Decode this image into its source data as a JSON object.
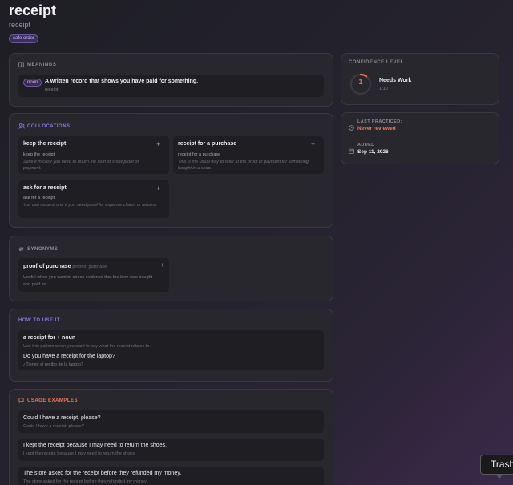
{
  "header": {
    "word": "receipt",
    "subtitle": "receipt",
    "tag": "cafe order"
  },
  "meanings": {
    "title": "MEANINGS",
    "pos": "noun",
    "definition": "A written record that shows you have paid for something.",
    "translation": "receipt"
  },
  "collocations": {
    "title": "COLLOCATIONS",
    "items": [
      {
        "phrase": "keep the receipt",
        "translation": "keep the receipt",
        "note": "Save it in case you need to return the item or show proof of payment."
      },
      {
        "phrase": "receipt for a purchase",
        "translation": "receipt for a purchase",
        "note": "This is the usual way to refer to the proof of payment for something bought in a shop."
      },
      {
        "phrase": "ask for a receipt",
        "translation": "ask for a receipt",
        "note": "You can request one if you need proof for expense claims or returns."
      }
    ],
    "add_glyph": "+"
  },
  "synonyms": {
    "title": "SYNONYMS",
    "word": "proof of purchase",
    "gloss": "- proof of purchase",
    "note": "Useful when you want to stress evidence that the item was bought and paid for.",
    "add_glyph": "+"
  },
  "how_to_use": {
    "title": "HOW TO USE IT",
    "pattern": "a receipt for + noun",
    "pattern_note": "Use this pattern when you want to say what the receipt relates to.",
    "example": "Do you have a receipt for the laptop?",
    "example_translation": "¿Tienes el recibo de la laptop?"
  },
  "usage_examples": {
    "title": "USAGE EXAMPLES",
    "items": [
      {
        "sentence": "Could I have a receipt, please?",
        "translation": "Could I have a receipt, please?"
      },
      {
        "sentence": "I kept the receipt because I may need to return the shoes.",
        "translation": "I kept the receipt because I may need to return the shoes."
      },
      {
        "sentence": "The store asked for the receipt before they refunded my money.",
        "translation": "The store asked for the receipt before they refunded my money."
      }
    ]
  },
  "confidence": {
    "title": "CONFIDENCE LEVEL",
    "value": "1",
    "level": 0.1,
    "label": "Needs Work",
    "score": "1/10"
  },
  "practice": {
    "last_label": "LAST PRACTICED:",
    "last_value": "Never reviewed",
    "added_label": "ADDED",
    "added_value": "Sep 11, 2026"
  },
  "tooltip": {
    "text": "Trash"
  },
  "colors": {
    "accent_purple": "#8a74e6",
    "accent_orange": "#e6795a"
  }
}
